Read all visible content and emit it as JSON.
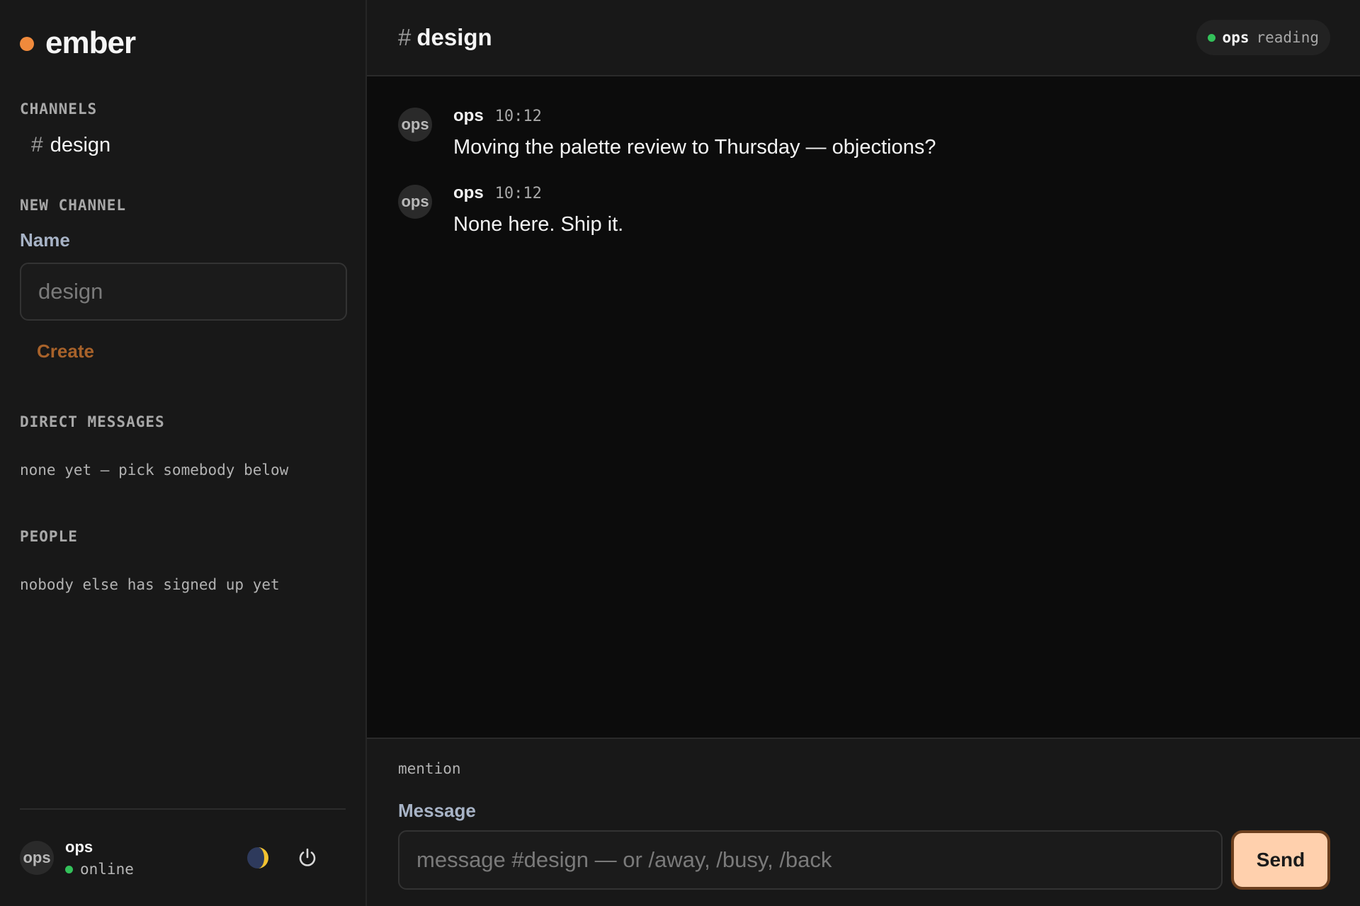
{
  "brand": {
    "name": "ember",
    "accent": "#f08a3c"
  },
  "sidebar": {
    "channels_label": "CHANNELS",
    "channels": [
      {
        "label": "design",
        "icon": "hash-icon"
      }
    ],
    "new_channel": {
      "label": "NEW CHANNEL",
      "name_label": "Name",
      "name_placeholder": "design",
      "create_label": "Create"
    },
    "direct_messages": {
      "label": "DIRECT MESSAGES",
      "empty_text": "none yet — pick somebody below"
    },
    "people": {
      "label": "PEOPLE",
      "empty_text": "nobody else has signed up yet"
    },
    "current_user": {
      "avatar": "ops",
      "name": "ops",
      "status": "online",
      "status_color": "#33c15a"
    },
    "footer_icons": [
      "theme-toggle-icon",
      "power-icon"
    ]
  },
  "header": {
    "hash": "#",
    "channel": "design",
    "presence": {
      "name": "ops",
      "state": "reading"
    }
  },
  "messages": [
    {
      "avatar": "ops",
      "author": "ops",
      "time": "10:12",
      "text": "Moving the palette review to Thursday — objections?"
    },
    {
      "avatar": "ops",
      "author": "ops",
      "time": "10:12",
      "text": "None here. Ship it."
    }
  ],
  "composer": {
    "hint": "mention",
    "label": "Message",
    "placeholder": "message #design — or /away, /busy, /back",
    "send_label": "Send",
    "send_color": "#ffd0ad"
  }
}
